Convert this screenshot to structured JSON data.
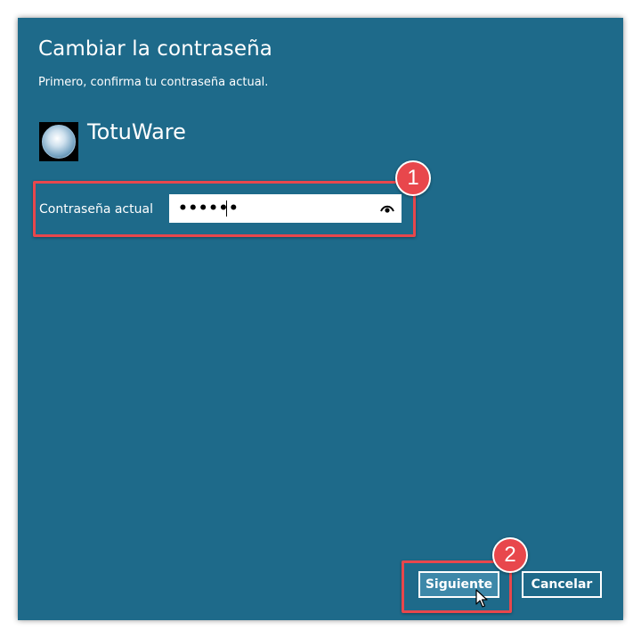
{
  "dialog": {
    "title": "Cambiar la contraseña",
    "subtitle": "Primero, confirma tu contraseña actual.",
    "user": {
      "name": "TotuWare",
      "avatar_icon": "user-avatar-icon"
    },
    "field": {
      "label": "Contraseña actual",
      "value_masked": "••••••",
      "reveal_icon": "eye-icon"
    },
    "buttons": {
      "next": "Siguiente",
      "cancel": "Cancelar"
    }
  },
  "annotations": {
    "step1": "1",
    "step2": "2",
    "color": "#e8474c"
  },
  "colors": {
    "background": "#1e6a8a",
    "accent": "#e8474c"
  }
}
